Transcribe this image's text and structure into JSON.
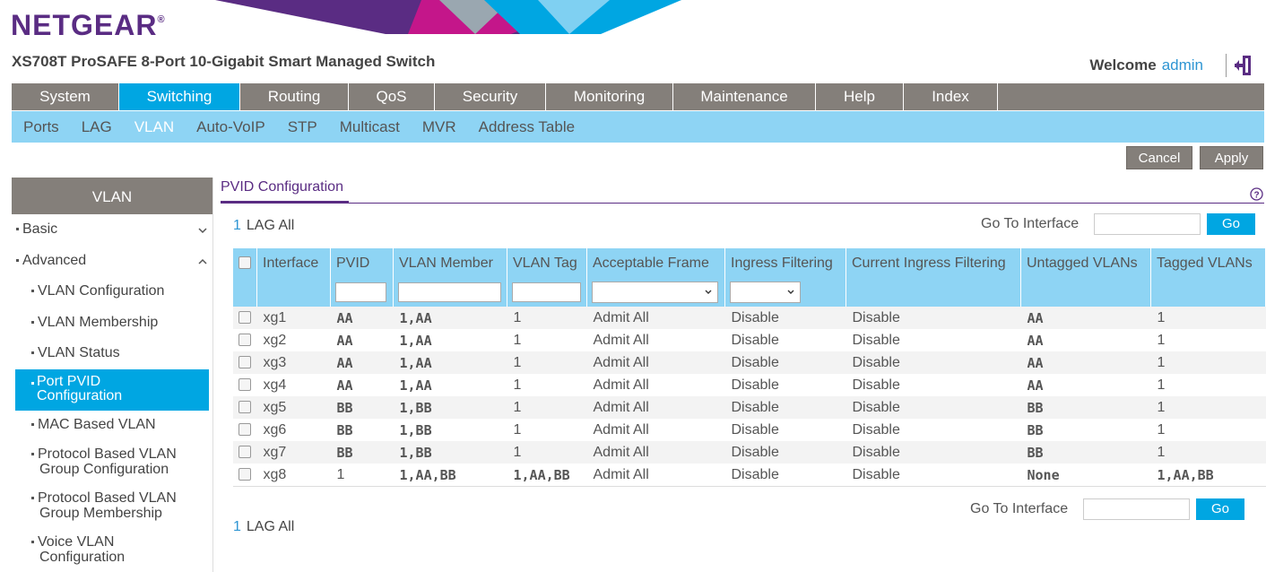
{
  "brand": {
    "logo": "NETGEAR",
    "product": "XS708T ProSAFE 8-Port 10-Gigabit Smart Managed Switch",
    "welcome": "Welcome",
    "user": "admin"
  },
  "colors": {
    "purple": "#5a2c83",
    "blue": "#00a6e2",
    "light_blue": "#8ed4f4",
    "grey": "#847f7a"
  },
  "mainnav": [
    "System",
    "Switching",
    "Routing",
    "QoS",
    "Security",
    "Monitoring",
    "Maintenance",
    "Help",
    "Index"
  ],
  "mainnav_active": "Switching",
  "subnav": [
    "Ports",
    "LAG",
    "VLAN",
    "Auto-VoIP",
    "STP",
    "Multicast",
    "MVR",
    "Address Table"
  ],
  "subnav_active": "VLAN",
  "actions": {
    "cancel": "Cancel",
    "apply": "Apply"
  },
  "sidebar": {
    "title": "VLAN",
    "basic": "Basic",
    "advanced": "Advanced",
    "items": [
      "VLAN Configuration",
      "VLAN Membership",
      "VLAN Status",
      "Port PVID Configuration",
      "MAC Based VLAN",
      "Protocol Based VLAN Group Configuration",
      "Protocol Based VLAN Group Membership",
      "Voice VLAN Configuration"
    ],
    "active": "Port PVID Configuration"
  },
  "content": {
    "title": "PVID Configuration",
    "pager": {
      "page": "1",
      "lag": "LAG",
      "all": "All"
    },
    "goto_label": "Go To Interface",
    "go": "Go"
  },
  "table": {
    "headers": [
      "Interface",
      "PVID",
      "VLAN Member",
      "VLAN Tag",
      "Acceptable Frame",
      "Ingress Filtering",
      "Current Ingress Filtering",
      "Untagged VLANs",
      "Tagged VLANs"
    ],
    "rows": [
      [
        "xg1",
        "AA",
        "1,AA",
        "1",
        "Admit All",
        "Disable",
        "Disable",
        "AA",
        "1"
      ],
      [
        "xg2",
        "AA",
        "1,AA",
        "1",
        "Admit All",
        "Disable",
        "Disable",
        "AA",
        "1"
      ],
      [
        "xg3",
        "AA",
        "1,AA",
        "1",
        "Admit All",
        "Disable",
        "Disable",
        "AA",
        "1"
      ],
      [
        "xg4",
        "AA",
        "1,AA",
        "1",
        "Admit All",
        "Disable",
        "Disable",
        "AA",
        "1"
      ],
      [
        "xg5",
        "BB",
        "1,BB",
        "1",
        "Admit All",
        "Disable",
        "Disable",
        "BB",
        "1"
      ],
      [
        "xg6",
        "BB",
        "1,BB",
        "1",
        "Admit All",
        "Disable",
        "Disable",
        "BB",
        "1"
      ],
      [
        "xg7",
        "BB",
        "1,BB",
        "1",
        "Admit All",
        "Disable",
        "Disable",
        "BB",
        "1"
      ],
      [
        "xg8",
        "1",
        "1,AA,BB",
        "1,AA,BB",
        "Admit All",
        "Disable",
        "Disable",
        "None",
        "1,AA,BB"
      ]
    ]
  }
}
